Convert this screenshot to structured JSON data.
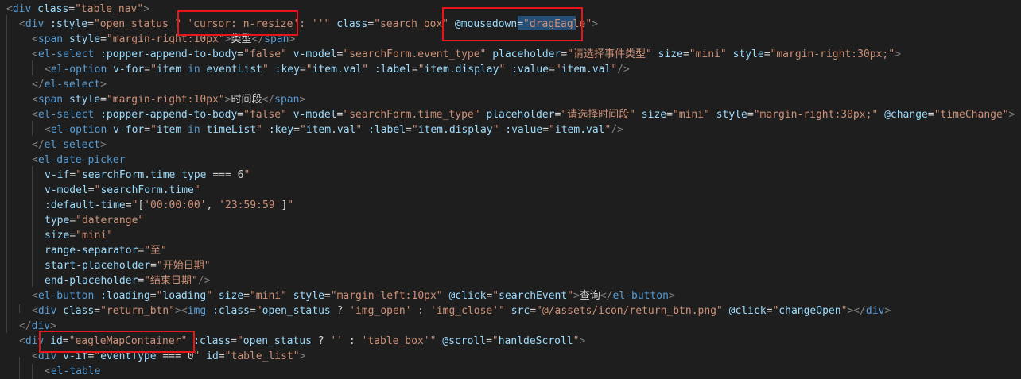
{
  "colors": {
    "background": "#1e1e1e",
    "punctuation": "#808080",
    "tag": "#569cd6",
    "attribute": "#9cdcfe",
    "string": "#ce9178",
    "text": "#d4d4d4",
    "highlight_box": "#e8161b",
    "selection": "#264f78"
  },
  "editor": {
    "lines": [
      [
        [
          "p",
          "<"
        ],
        [
          "t",
          "div"
        ],
        [
          "x",
          " "
        ],
        [
          "a",
          "class"
        ],
        [
          "x",
          "="
        ],
        [
          "s",
          "\"table_nav\""
        ],
        [
          "p",
          ">"
        ]
      ],
      [
        [
          "p",
          "<"
        ],
        [
          "t",
          "div"
        ],
        [
          "x",
          " "
        ],
        [
          "a",
          ":style"
        ],
        [
          "x",
          "="
        ],
        [
          "s",
          "\"open_status ? "
        ],
        [
          "s",
          "'cursor: n-resize'"
        ],
        [
          "s",
          ": ''\""
        ],
        [
          "x",
          " "
        ],
        [
          "a",
          "class"
        ],
        [
          "x",
          "="
        ],
        [
          "s",
          "\"search_box\""
        ],
        [
          "x",
          " "
        ],
        [
          "a",
          "@mousedown"
        ],
        [
          "x",
          "="
        ],
        [
          "s",
          "\""
        ],
        [
          "s",
          "dragEagle"
        ],
        [
          "s",
          "\""
        ],
        [
          "p",
          ">"
        ]
      ],
      [
        [
          "p",
          "<"
        ],
        [
          "t",
          "span"
        ],
        [
          "x",
          " "
        ],
        [
          "a",
          "style"
        ],
        [
          "x",
          "="
        ],
        [
          "s",
          "\"margin-right:10px\""
        ],
        [
          "p",
          ">"
        ],
        [
          "x",
          "类型"
        ],
        [
          "p",
          "</"
        ],
        [
          "t",
          "span"
        ],
        [
          "p",
          ">"
        ]
      ],
      [
        [
          "p",
          "<"
        ],
        [
          "t",
          "el-select"
        ],
        [
          "x",
          " "
        ],
        [
          "a",
          ":popper-append-to-body"
        ],
        [
          "x",
          "="
        ],
        [
          "s",
          "\"false\""
        ],
        [
          "x",
          " "
        ],
        [
          "a",
          "v-model"
        ],
        [
          "x",
          "="
        ],
        [
          "s",
          "\"searchForm.event_type\""
        ],
        [
          "x",
          " "
        ],
        [
          "a",
          "placeholder"
        ],
        [
          "x",
          "="
        ],
        [
          "s",
          "\"请选择事件类型\""
        ],
        [
          "x",
          " "
        ],
        [
          "a",
          "size"
        ],
        [
          "x",
          "="
        ],
        [
          "s",
          "\"mini\""
        ],
        [
          "x",
          " "
        ],
        [
          "a",
          "style"
        ],
        [
          "x",
          "="
        ],
        [
          "s",
          "\"margin-right:30px;\""
        ],
        [
          "p",
          ">"
        ]
      ],
      [
        [
          "p",
          "<"
        ],
        [
          "t",
          "el-option"
        ],
        [
          "x",
          " "
        ],
        [
          "a",
          "v-for"
        ],
        [
          "x",
          "="
        ],
        [
          "s",
          "\""
        ],
        [
          "a",
          "item"
        ],
        [
          "x",
          " "
        ],
        [
          "t",
          "in"
        ],
        [
          "x",
          " "
        ],
        [
          "a",
          "eventList"
        ],
        [
          "s",
          "\""
        ],
        [
          "x",
          " "
        ],
        [
          "a",
          ":key"
        ],
        [
          "x",
          "="
        ],
        [
          "s",
          "\""
        ],
        [
          "a",
          "item.val"
        ],
        [
          "s",
          "\""
        ],
        [
          "x",
          " "
        ],
        [
          "a",
          ":label"
        ],
        [
          "x",
          "="
        ],
        [
          "s",
          "\""
        ],
        [
          "a",
          "item.display"
        ],
        [
          "s",
          "\""
        ],
        [
          "x",
          " "
        ],
        [
          "a",
          ":value"
        ],
        [
          "x",
          "="
        ],
        [
          "s",
          "\""
        ],
        [
          "a",
          "item.val"
        ],
        [
          "s",
          "\""
        ],
        [
          "p",
          "/>"
        ]
      ],
      [
        [
          "p",
          "</"
        ],
        [
          "t",
          "el-select"
        ],
        [
          "p",
          ">"
        ]
      ],
      [
        [
          "p",
          "<"
        ],
        [
          "t",
          "span"
        ],
        [
          "x",
          " "
        ],
        [
          "a",
          "style"
        ],
        [
          "x",
          "="
        ],
        [
          "s",
          "\"margin-right:10px\""
        ],
        [
          "p",
          ">"
        ],
        [
          "x",
          "时间段"
        ],
        [
          "p",
          "</"
        ],
        [
          "t",
          "span"
        ],
        [
          "p",
          ">"
        ]
      ],
      [
        [
          "p",
          "<"
        ],
        [
          "t",
          "el-select"
        ],
        [
          "x",
          " "
        ],
        [
          "a",
          ":popper-append-to-body"
        ],
        [
          "x",
          "="
        ],
        [
          "s",
          "\"false\""
        ],
        [
          "x",
          " "
        ],
        [
          "a",
          "v-model"
        ],
        [
          "x",
          "="
        ],
        [
          "s",
          "\"searchForm.time_type\""
        ],
        [
          "x",
          " "
        ],
        [
          "a",
          "placeholder"
        ],
        [
          "x",
          "="
        ],
        [
          "s",
          "\"请选择时间段\""
        ],
        [
          "x",
          " "
        ],
        [
          "a",
          "size"
        ],
        [
          "x",
          "="
        ],
        [
          "s",
          "\"mini\""
        ],
        [
          "x",
          " "
        ],
        [
          "a",
          "style"
        ],
        [
          "x",
          "="
        ],
        [
          "s",
          "\"margin-right:30px;\""
        ],
        [
          "x",
          " "
        ],
        [
          "a",
          "@change"
        ],
        [
          "x",
          "="
        ],
        [
          "s",
          "\"timeChange\""
        ],
        [
          "p",
          ">"
        ]
      ],
      [
        [
          "p",
          "<"
        ],
        [
          "t",
          "el-option"
        ],
        [
          "x",
          " "
        ],
        [
          "a",
          "v-for"
        ],
        [
          "x",
          "="
        ],
        [
          "s",
          "\""
        ],
        [
          "a",
          "item"
        ],
        [
          "x",
          " "
        ],
        [
          "t",
          "in"
        ],
        [
          "x",
          " "
        ],
        [
          "a",
          "timeList"
        ],
        [
          "s",
          "\""
        ],
        [
          "x",
          " "
        ],
        [
          "a",
          ":key"
        ],
        [
          "x",
          "="
        ],
        [
          "s",
          "\""
        ],
        [
          "a",
          "item.val"
        ],
        [
          "s",
          "\""
        ],
        [
          "x",
          " "
        ],
        [
          "a",
          ":label"
        ],
        [
          "x",
          "="
        ],
        [
          "s",
          "\""
        ],
        [
          "a",
          "item.display"
        ],
        [
          "s",
          "\""
        ],
        [
          "x",
          " "
        ],
        [
          "a",
          ":value"
        ],
        [
          "x",
          "="
        ],
        [
          "s",
          "\""
        ],
        [
          "a",
          "item.val"
        ],
        [
          "s",
          "\""
        ],
        [
          "p",
          "/>"
        ]
      ],
      [
        [
          "p",
          "</"
        ],
        [
          "t",
          "el-select"
        ],
        [
          "p",
          ">"
        ]
      ],
      [
        [
          "p",
          "<"
        ],
        [
          "t",
          "el-date-picker"
        ]
      ],
      [
        [
          "a",
          "v-if"
        ],
        [
          "x",
          "="
        ],
        [
          "s",
          "\""
        ],
        [
          "a",
          "searchForm.time_type"
        ],
        [
          "x",
          " === 6"
        ],
        [
          "s",
          "\""
        ]
      ],
      [
        [
          "a",
          "v-model"
        ],
        [
          "x",
          "="
        ],
        [
          "s",
          "\""
        ],
        [
          "a",
          "searchForm.time"
        ],
        [
          "s",
          "\""
        ]
      ],
      [
        [
          "a",
          ":default-time"
        ],
        [
          "x",
          "="
        ],
        [
          "s",
          "\""
        ],
        [
          "x",
          "["
        ],
        [
          "s",
          "'00:00:00'"
        ],
        [
          "x",
          ", "
        ],
        [
          "s",
          "'23:59:59'"
        ],
        [
          "x",
          "]"
        ],
        [
          "s",
          "\""
        ]
      ],
      [
        [
          "a",
          "type"
        ],
        [
          "x",
          "="
        ],
        [
          "s",
          "\"daterange\""
        ]
      ],
      [
        [
          "a",
          "size"
        ],
        [
          "x",
          "="
        ],
        [
          "s",
          "\"mini\""
        ]
      ],
      [
        [
          "a",
          "range-separator"
        ],
        [
          "x",
          "="
        ],
        [
          "s",
          "\"至\""
        ]
      ],
      [
        [
          "a",
          "start-placeholder"
        ],
        [
          "x",
          "="
        ],
        [
          "s",
          "\"开始日期\""
        ]
      ],
      [
        [
          "a",
          "end-placeholder"
        ],
        [
          "x",
          "="
        ],
        [
          "s",
          "\"结束日期\""
        ],
        [
          "p",
          "/>"
        ]
      ],
      [
        [
          "p",
          "<"
        ],
        [
          "t",
          "el-button"
        ],
        [
          "x",
          " "
        ],
        [
          "a",
          ":loading"
        ],
        [
          "x",
          "="
        ],
        [
          "s",
          "\""
        ],
        [
          "a",
          "loading"
        ],
        [
          "s",
          "\""
        ],
        [
          "x",
          " "
        ],
        [
          "a",
          "size"
        ],
        [
          "x",
          "="
        ],
        [
          "s",
          "\"mini\""
        ],
        [
          "x",
          " "
        ],
        [
          "a",
          "style"
        ],
        [
          "x",
          "="
        ],
        [
          "s",
          "\"margin-left:10px\""
        ],
        [
          "x",
          " "
        ],
        [
          "a",
          "@click"
        ],
        [
          "x",
          "="
        ],
        [
          "s",
          "\""
        ],
        [
          "a",
          "searchEvent"
        ],
        [
          "s",
          "\""
        ],
        [
          "p",
          ">"
        ],
        [
          "x",
          "查询"
        ],
        [
          "p",
          "</"
        ],
        [
          "t",
          "el-button"
        ],
        [
          "p",
          ">"
        ]
      ],
      [
        [
          "p",
          "<"
        ],
        [
          "t",
          "div"
        ],
        [
          "x",
          " "
        ],
        [
          "a",
          "class"
        ],
        [
          "x",
          "="
        ],
        [
          "s",
          "\"return_btn\""
        ],
        [
          "p",
          ">"
        ],
        [
          "p",
          "<"
        ],
        [
          "t",
          "img"
        ],
        [
          "x",
          " "
        ],
        [
          "a",
          ":class"
        ],
        [
          "x",
          "="
        ],
        [
          "s",
          "\""
        ],
        [
          "a",
          "open_status"
        ],
        [
          "x",
          " ? "
        ],
        [
          "s",
          "'img_open'"
        ],
        [
          "x",
          " : "
        ],
        [
          "s",
          "'img_close'"
        ],
        [
          "s",
          "\""
        ],
        [
          "x",
          " "
        ],
        [
          "a",
          "src"
        ],
        [
          "x",
          "="
        ],
        [
          "s",
          "\"@/assets/icon/return_btn.png\""
        ],
        [
          "x",
          " "
        ],
        [
          "a",
          "@click"
        ],
        [
          "x",
          "="
        ],
        [
          "s",
          "\""
        ],
        [
          "a",
          "changeOpen"
        ],
        [
          "s",
          "\""
        ],
        [
          "p",
          ">"
        ],
        [
          "p",
          "</"
        ],
        [
          "t",
          "div"
        ],
        [
          "p",
          ">"
        ]
      ],
      [
        [
          "p",
          "</"
        ],
        [
          "t",
          "div"
        ],
        [
          "p",
          ">"
        ]
      ],
      [
        [
          "p",
          "<"
        ],
        [
          "t",
          "div"
        ],
        [
          "x",
          " "
        ],
        [
          "a",
          "id"
        ],
        [
          "x",
          "="
        ],
        [
          "s",
          "\"eagleMapContainer\""
        ],
        [
          "x",
          " "
        ],
        [
          "a",
          ":class"
        ],
        [
          "x",
          "="
        ],
        [
          "s",
          "\""
        ],
        [
          "a",
          "open_status"
        ],
        [
          "x",
          " ? "
        ],
        [
          "s",
          "''"
        ],
        [
          "x",
          " : "
        ],
        [
          "s",
          "'table_box'"
        ],
        [
          "s",
          "\""
        ],
        [
          "x",
          " "
        ],
        [
          "a",
          "@scroll"
        ],
        [
          "x",
          "="
        ],
        [
          "s",
          "\""
        ],
        [
          "a",
          "hanldeScroll"
        ],
        [
          "s",
          "\""
        ],
        [
          "p",
          ">"
        ]
      ],
      [
        [
          "p",
          "<"
        ],
        [
          "t",
          "div"
        ],
        [
          "x",
          " "
        ],
        [
          "a",
          "v-if"
        ],
        [
          "x",
          "="
        ],
        [
          "s",
          "\""
        ],
        [
          "a",
          "eventType"
        ],
        [
          "x",
          " === 0"
        ],
        [
          "s",
          "\""
        ],
        [
          "x",
          " "
        ],
        [
          "a",
          "id"
        ],
        [
          "x",
          "="
        ],
        [
          "s",
          "\"table_list\""
        ],
        [
          "p",
          ">"
        ]
      ],
      [
        [
          "p",
          "<"
        ],
        [
          "t",
          "el-table"
        ]
      ]
    ]
  }
}
